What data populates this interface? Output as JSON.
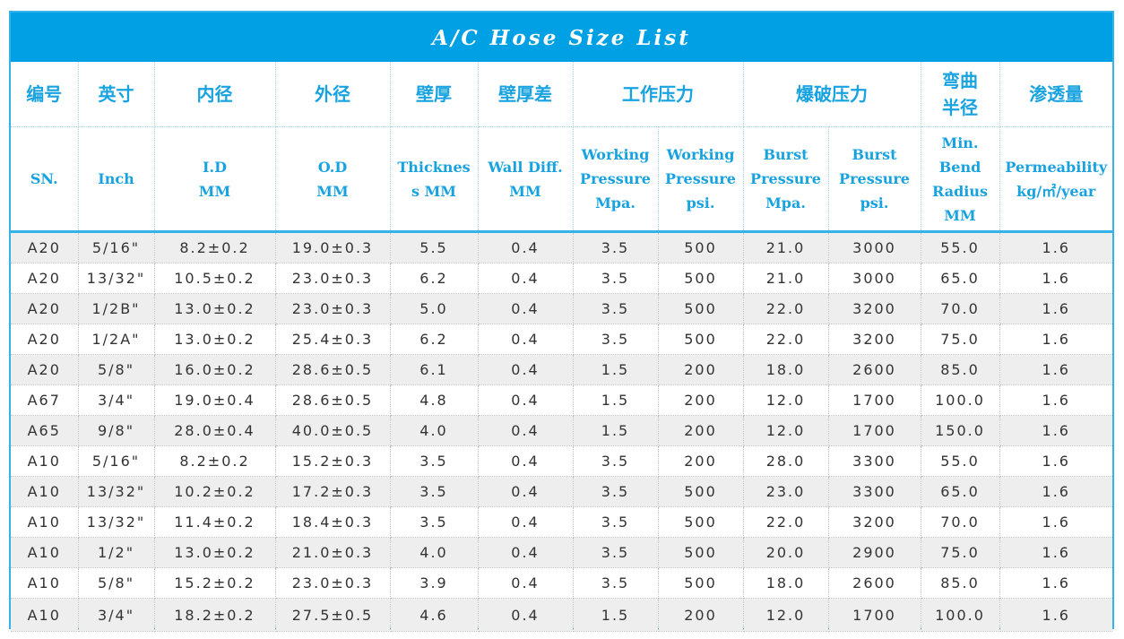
{
  "title": "A/C Hose Size List",
  "header_cn": {
    "sn": "编号",
    "inch": "英寸",
    "id": "内径",
    "od": "外径",
    "thickness": "壁厚",
    "wall_diff": "壁厚差",
    "working_pressure": "工作压力",
    "burst_pressure": "爆破压力",
    "bend_radius_1": "弯曲",
    "bend_radius_2": "半径",
    "permeability": "渗透量"
  },
  "header_en": {
    "sn": "SN.",
    "inch": "Inch",
    "id_1": "I.D",
    "id_2": "MM",
    "od_1": "O.D",
    "od_2": "MM",
    "thickness_1": "Thicknes",
    "thickness_2": "s MM",
    "wall_diff_1": "Wall Diff.",
    "wall_diff_2": "MM",
    "wp_mpa_1": "Working",
    "wp_mpa_2": "Pressure",
    "wp_mpa_3": "Mpa.",
    "wp_psi_1": "Working",
    "wp_psi_2": "Pressure",
    "wp_psi_3": "psi.",
    "bp_mpa_1": "Burst",
    "bp_mpa_2": "Pressure",
    "bp_mpa_3": "Mpa.",
    "bp_psi_1": "Burst",
    "bp_psi_2": "Pressure",
    "bp_psi_3": "psi.",
    "bend_1": "Min.",
    "bend_2": "Bend",
    "bend_3": "Radius",
    "bend_4": "MM",
    "perm_1": "Permeability",
    "perm_2": "kg/㎡/year"
  },
  "rows": [
    [
      "A20",
      "5/16\"",
      "8.2±0.2",
      "19.0±0.3",
      "5.5",
      "0.4",
      "3.5",
      "500",
      "21.0",
      "3000",
      "55.0",
      "1.6"
    ],
    [
      "A20",
      "13/32\"",
      "10.5±0.2",
      "23.0±0.3",
      "6.2",
      "0.4",
      "3.5",
      "500",
      "21.0",
      "3000",
      "65.0",
      "1.6"
    ],
    [
      "A20",
      "1/2B\"",
      "13.0±0.2",
      "23.0±0.3",
      "5.0",
      "0.4",
      "3.5",
      "500",
      "22.0",
      "3200",
      "70.0",
      "1.6"
    ],
    [
      "A20",
      "1/2A\"",
      "13.0±0.2",
      "25.4±0.3",
      "6.2",
      "0.4",
      "3.5",
      "500",
      "22.0",
      "3200",
      "75.0",
      "1.6"
    ],
    [
      "A20",
      "5/8\"",
      "16.0±0.2",
      "28.6±0.5",
      "6.1",
      "0.4",
      "1.5",
      "200",
      "18.0",
      "2600",
      "85.0",
      "1.6"
    ],
    [
      "A67",
      "3/4\"",
      "19.0±0.4",
      "28.6±0.5",
      "4.8",
      "0.4",
      "1.5",
      "200",
      "12.0",
      "1700",
      "100.0",
      "1.6"
    ],
    [
      "A65",
      "9/8\"",
      "28.0±0.4",
      "40.0±0.5",
      "4.0",
      "0.4",
      "1.5",
      "200",
      "12.0",
      "1700",
      "150.0",
      "1.6"
    ],
    [
      "A10",
      "5/16\"",
      "8.2±0.2",
      "15.2±0.3",
      "3.5",
      "0.4",
      "3.5",
      "200",
      "28.0",
      "3300",
      "55.0",
      "1.6"
    ],
    [
      "A10",
      "13/32\"",
      "10.2±0.2",
      "17.2±0.3",
      "3.5",
      "0.4",
      "3.5",
      "500",
      "23.0",
      "3300",
      "65.0",
      "1.6"
    ],
    [
      "A10",
      "13/32\"",
      "11.4±0.2",
      "18.4±0.3",
      "3.5",
      "0.4",
      "3.5",
      "500",
      "22.0",
      "3200",
      "70.0",
      "1.6"
    ],
    [
      "A10",
      "1/2\"",
      "13.0±0.2",
      "21.0±0.3",
      "4.0",
      "0.4",
      "3.5",
      "500",
      "20.0",
      "2900",
      "75.0",
      "1.6"
    ],
    [
      "A10",
      "5/8\"",
      "15.2±0.2",
      "23.0±0.3",
      "3.9",
      "0.4",
      "3.5",
      "500",
      "18.0",
      "2600",
      "85.0",
      "1.6"
    ],
    [
      "A10",
      "3/4\"",
      "18.2±0.2",
      "27.5±0.5",
      "4.6",
      "0.4",
      "1.5",
      "200",
      "12.0",
      "1700",
      "100.0",
      "1.6"
    ]
  ],
  "colors": {
    "title_bg": "#00a0e4",
    "header_text": "#18a3e0",
    "border": "#33b3e9",
    "stripe": "#eeeeee"
  }
}
